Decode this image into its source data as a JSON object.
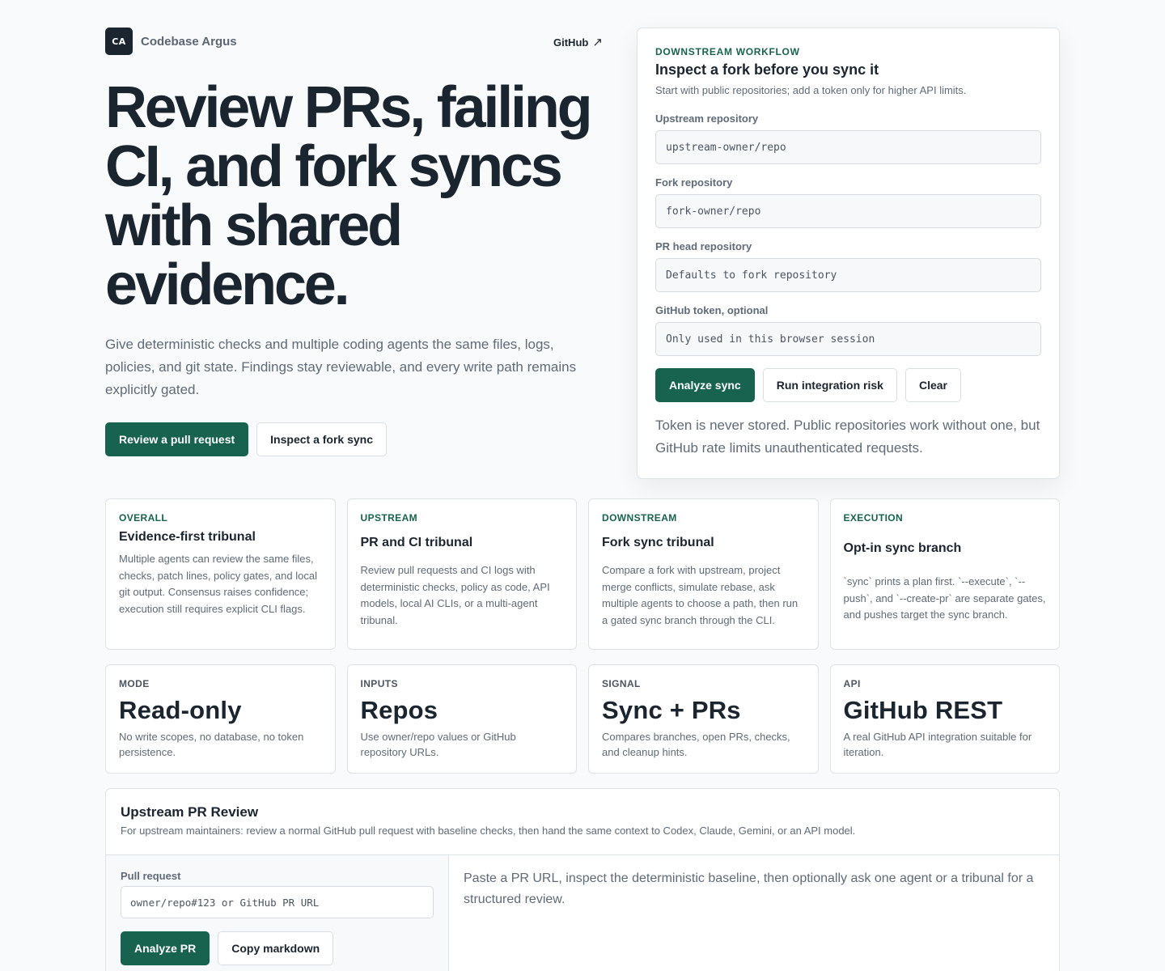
{
  "brand": {
    "logo_text": "CA",
    "name": "Codebase Argus"
  },
  "nav": {
    "github_label": "GitHub",
    "github_arrow": "↗"
  },
  "hero": {
    "title": "Review PRs, failing CI, and fork syncs with shared evidence.",
    "subtitle": "Give deterministic checks and multiple coding agents the same files, logs, policies, and git state. Findings stay reviewable, and every write path remains explicitly gated.",
    "primary_button": "Review a pull request",
    "secondary_button": "Inspect a fork sync"
  },
  "workflow": {
    "eyebrow": "DOWNSTREAM WORKFLOW",
    "title": "Inspect a fork before you sync it",
    "description": "Start with public repositories; add a token only for higher API limits.",
    "fields": [
      {
        "label": "Upstream repository",
        "placeholder": "upstream-owner/repo",
        "value": ""
      },
      {
        "label": "Fork repository",
        "placeholder": "fork-owner/repo",
        "value": ""
      },
      {
        "label": "PR head repository",
        "placeholder": "Defaults to fork repository",
        "value": ""
      },
      {
        "label": "GitHub token, optional",
        "placeholder": "Only used in this browser session",
        "value": ""
      }
    ],
    "buttons": {
      "analyze": "Analyze sync",
      "risk": "Run integration risk",
      "clear": "Clear"
    },
    "note": "Token is never stored. Public repositories work without one, but GitHub rate limits unauthenticated requests."
  },
  "features": [
    {
      "eyebrow": "OVERALL",
      "title": "Evidence-first tribunal",
      "text": "Multiple agents can review the same files, checks, patch lines, policy gates, and local git output. Consensus raises confidence; execution still requires explicit CLI flags."
    },
    {
      "eyebrow": "UPSTREAM",
      "title": "PR and CI tribunal",
      "text": "Review pull requests and CI logs with deterministic checks, policy as code, API models, local AI CLIs, or a multi-agent tribunal."
    },
    {
      "eyebrow": "DOWNSTREAM",
      "title": "Fork sync tribunal",
      "text": "Compare a fork with upstream, project merge conflicts, simulate rebase, ask multiple agents to choose a path, then run a gated sync branch through the CLI."
    },
    {
      "eyebrow": "EXECUTION",
      "title": "Opt-in sync branch",
      "text": "`sync` prints a plan first. `--execute`, `--push`, and `--create-pr` are separate gates, and pushes target the sync branch."
    }
  ],
  "stats": [
    {
      "eyebrow": "MODE",
      "value": "Read-only",
      "text": "No write scopes, no database, no token persistence."
    },
    {
      "eyebrow": "INPUTS",
      "value": "Repos",
      "text": "Use owner/repo values or GitHub repository URLs."
    },
    {
      "eyebrow": "SIGNAL",
      "value": "Sync + PRs",
      "text": "Compares branches, open PRs, checks, and cleanup hints."
    },
    {
      "eyebrow": "API",
      "value": "GitHub REST",
      "text": "A real GitHub API integration suitable for iteration."
    }
  ],
  "pr_review": {
    "title": "Upstream PR Review",
    "description": "For upstream maintainers: review a normal GitHub pull request with baseline checks, then hand the same context to Codex, Claude, Gemini, or an API model.",
    "input_label": "Pull request",
    "input_placeholder": "owner/repo#123 or GitHub PR URL",
    "input_value": "",
    "analyze_button": "Analyze PR",
    "copy_button": "Copy markdown",
    "result_text": "Paste a PR URL, inspect the deterministic baseline, then optionally ask one agent or a tribunal for a structured review."
  },
  "colors": {
    "accent": "#17634f",
    "ink": "#1b2530",
    "muted": "#5f6b78",
    "border": "#dde2e7",
    "background": "#f9fafb"
  }
}
